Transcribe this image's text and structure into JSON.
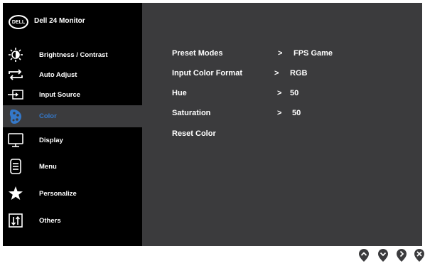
{
  "header": {
    "logo_text": "DELL",
    "model": "Dell 24 Monitor"
  },
  "menu": [
    {
      "label": "Brightness / Contrast",
      "icon": "brightness-icon"
    },
    {
      "label": "Auto Adjust",
      "icon": "auto-adjust-icon"
    },
    {
      "label": "Input Source",
      "icon": "input-source-icon"
    },
    {
      "label": "Color",
      "icon": "color-palette-icon",
      "active": true
    },
    {
      "label": "Display",
      "icon": "display-monitor-icon"
    },
    {
      "label": "Menu",
      "icon": "menu-document-icon"
    },
    {
      "label": "Personalize",
      "icon": "star-icon"
    },
    {
      "label": "Others",
      "icon": "others-sliders-icon"
    }
  ],
  "color_settings": [
    {
      "label": "Preset Modes",
      "arrow": ">",
      "value": "FPS Game"
    },
    {
      "label": "Input Color Format",
      "arrow": ">",
      "value": "RGB"
    },
    {
      "label": "Hue",
      "arrow": ">",
      "value": "50"
    },
    {
      "label": "Saturation",
      "arrow": ">",
      "value": "50"
    },
    {
      "label": "Reset Color",
      "arrow": "",
      "value": ""
    }
  ],
  "controls": [
    "up-arrow-icon",
    "down-arrow-icon",
    "right-arrow-icon",
    "close-icon"
  ],
  "colors": {
    "accent": "#3478c9",
    "panel": "#3b3b3d",
    "sidebar": "#000000"
  }
}
